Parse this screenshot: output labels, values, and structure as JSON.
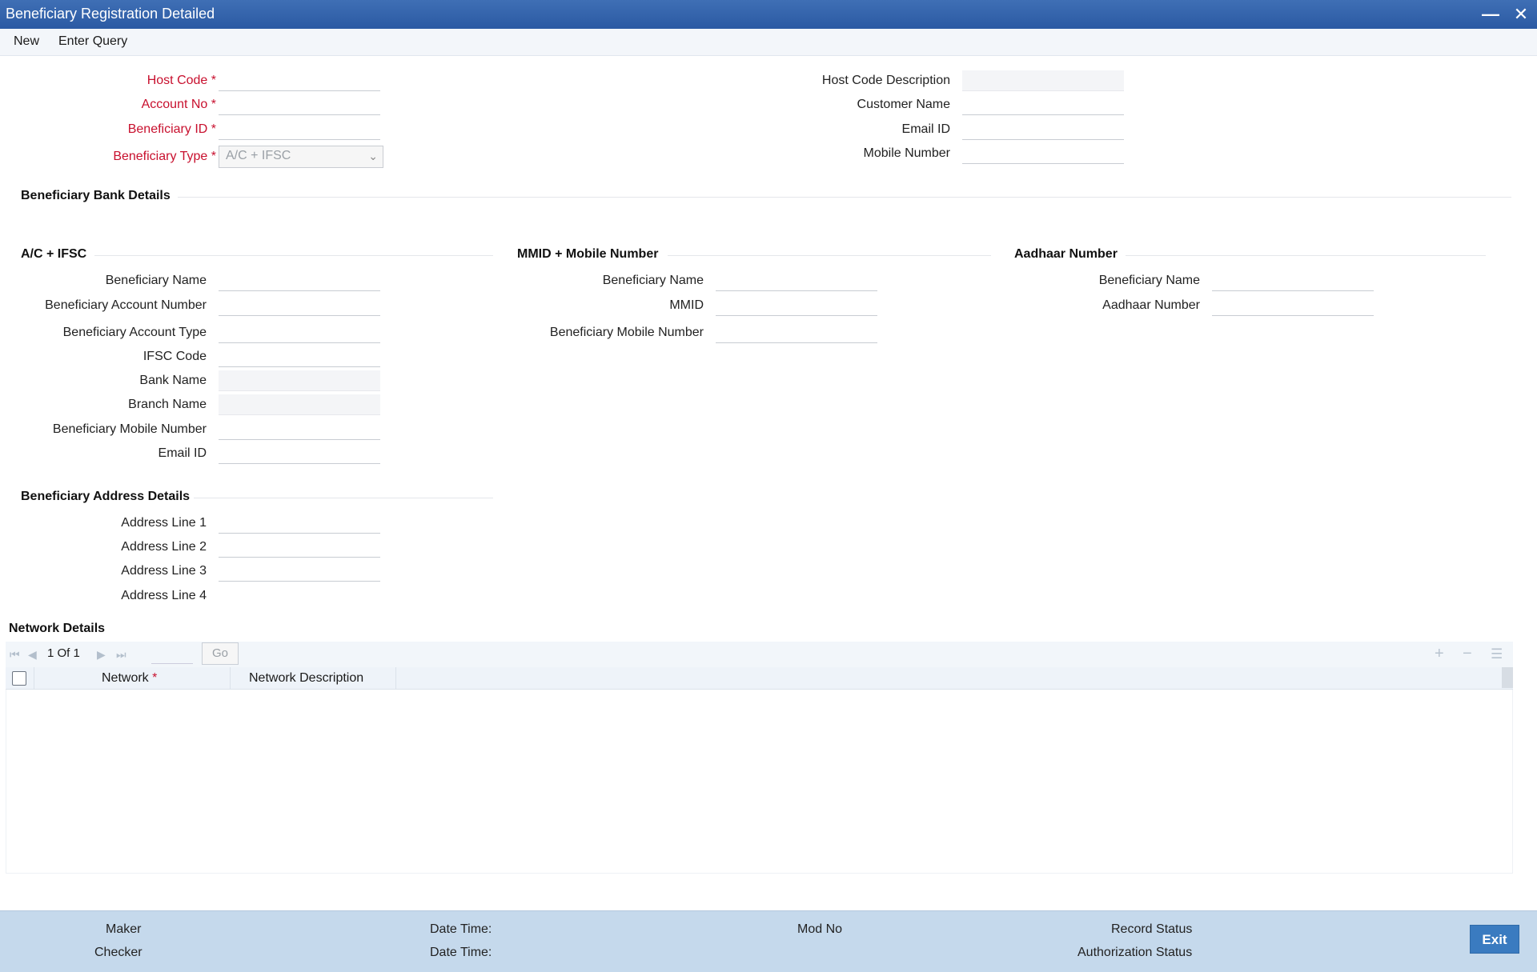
{
  "window": {
    "title": "Beneficiary Registration Detailed"
  },
  "menu": {
    "new": "New",
    "enter_query": "Enter Query"
  },
  "header": {
    "host_code": {
      "label": "Host Code",
      "value": ""
    },
    "account_no": {
      "label": "Account No",
      "value": ""
    },
    "beneficiary_id": {
      "label": "Beneficiary ID",
      "value": ""
    },
    "beneficiary_type": {
      "label": "Beneficiary Type",
      "value": "A/C + IFSC"
    },
    "host_code_description": {
      "label": "Host Code Description",
      "value": ""
    },
    "customer_name": {
      "label": "Customer Name",
      "value": ""
    },
    "email_id": {
      "label": "Email ID",
      "value": ""
    },
    "mobile_number": {
      "label": "Mobile Number",
      "value": ""
    },
    "required_mark": "*"
  },
  "bank_details": {
    "title": "Beneficiary Bank Details",
    "acifsc": {
      "title": "A/C + IFSC",
      "beneficiary_name": "Beneficiary Name",
      "beneficiary_account_number": "Beneficiary Account Number",
      "beneficiary_account_type": "Beneficiary Account Type",
      "ifsc_code": "IFSC Code",
      "bank_name": "Bank Name",
      "branch_name": "Branch Name",
      "beneficiary_mobile_number": "Beneficiary Mobile Number",
      "email_id": "Email ID"
    },
    "mmid": {
      "title": "MMID + Mobile Number",
      "beneficiary_name": "Beneficiary Name",
      "mmid": "MMID",
      "beneficiary_mobile_number": "Beneficiary Mobile Number"
    },
    "aadhaar": {
      "title": "Aadhaar Number",
      "beneficiary_name": "Beneficiary Name",
      "aadhaar_number": "Aadhaar Number"
    }
  },
  "address": {
    "title": "Beneficiary Address Details",
    "line1": "Address Line 1",
    "line2": "Address Line 2",
    "line3": "Address Line 3",
    "line4": "Address Line 4"
  },
  "network": {
    "title": "Network Details",
    "page_current": "1",
    "page_of": "Of",
    "page_total": "1",
    "go": "Go",
    "col_network": "Network",
    "col_network_description": "Network Description",
    "required_mark": "*"
  },
  "footer": {
    "maker": "Maker",
    "checker": "Checker",
    "date_time_1": "Date Time:",
    "date_time_2": "Date Time:",
    "mod_no": "Mod No",
    "record_status": "Record Status",
    "authorization_status": "Authorization Status",
    "exit": "Exit"
  },
  "icons": {
    "minimize": "minimize-icon",
    "close": "close-icon",
    "first": "first-page-icon",
    "prev": "prev-page-icon",
    "next": "next-page-icon",
    "last": "last-page-icon",
    "add_row": "plus-icon",
    "delete_row": "minus-icon",
    "view_rows": "list-icon"
  }
}
